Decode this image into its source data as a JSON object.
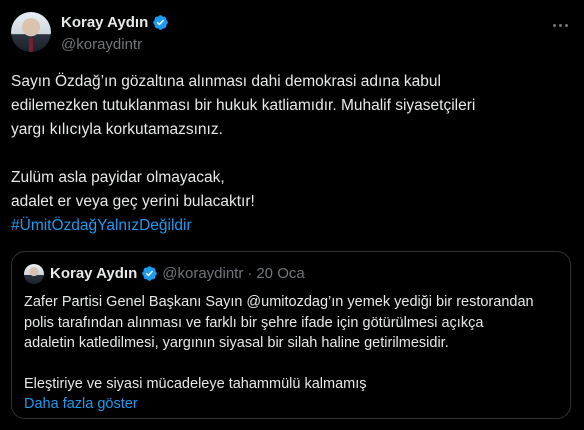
{
  "tweet": {
    "author_name": "Koray Aydın",
    "author_handle": "@koraydintr",
    "text_lines": [
      "Sayın Özdağ’ın gözaltına alınması dahi demokrasi adına kabul",
      "edilemezken tutuklanması bir hukuk katliamıdır. Muhalif siyasetçileri",
      "yargı kılıcıyla korkutamazsınız.",
      "Zulüm asla payidar olmayacak,",
      "adalet er veya geç yerini bulacaktır!"
    ],
    "hashtag": "#ÜmitÖzdağYalnızDeğildir"
  },
  "quote": {
    "author_name": "Koray Aydın",
    "author_handle": "@koraydintr",
    "separator": "·",
    "date": "20 Oca",
    "text_lines": [
      "Zafer Partisi Genel Başkanı Sayın @umitozdag’ın yemek yediği bir restorandan",
      "polis tarafından alınması ve farklı bir şehre ifade için götürülmesi açıkça",
      "adaletin katledilmesi, yargının siyasal bir silah haline getirilmesidir.",
      "Eleştiriye ve siyasi mücadeleye tahammülü kalmamış"
    ],
    "show_more": "Daha fazla göster"
  },
  "colors": {
    "background": "#000000",
    "text": "#e7e9ea",
    "secondary": "#71767b",
    "link": "#1d9bf0",
    "verified": "#1d9bf0",
    "border": "#2f3336"
  },
  "icons": {
    "verified": "verified-badge-icon",
    "more": "more-horizontal-icon"
  }
}
